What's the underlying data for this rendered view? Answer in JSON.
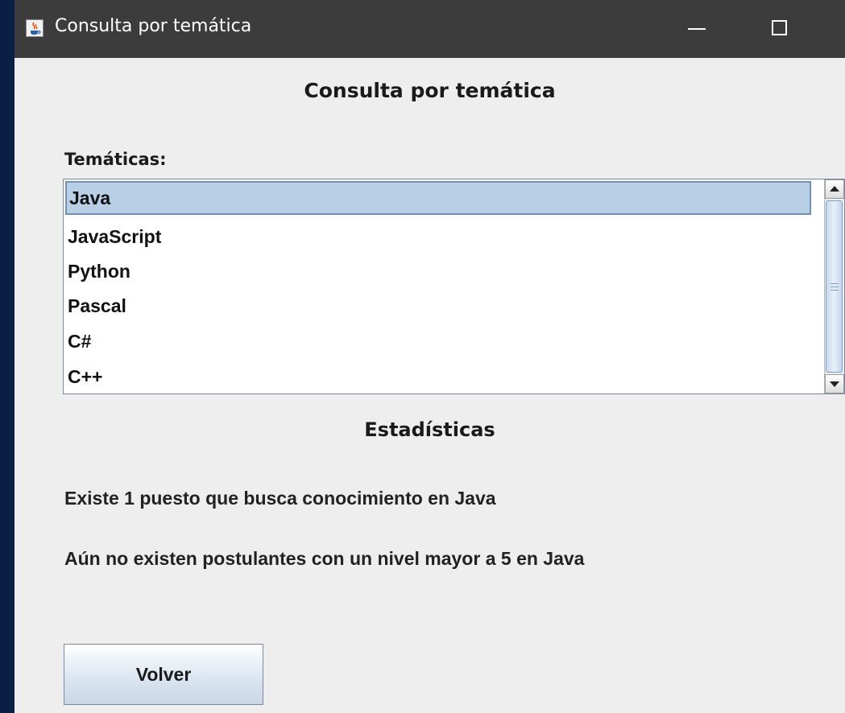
{
  "window": {
    "title": "Consulta por temática",
    "icon": "java-cup-icon"
  },
  "dialog": {
    "heading": "Consulta por temática"
  },
  "tematicas": {
    "label": "Temáticas:",
    "selected_index": 0,
    "items": [
      "Java",
      "JavaScript",
      "Python",
      "Pascal",
      "C#",
      "C++"
    ]
  },
  "estadisticas": {
    "heading": "Estadísticas",
    "line_1": "Existe 1 puesto que busca conocimiento en Java",
    "line_2": "Aún no existen postulantes con un nivel mayor a 5 en Java"
  },
  "buttons": {
    "volver": "Volver"
  },
  "colors": {
    "titlebar": "#3c3c3c",
    "panel": "#eeeeee",
    "selection": "#b8cfe5",
    "desktop": "#0a1f44"
  }
}
